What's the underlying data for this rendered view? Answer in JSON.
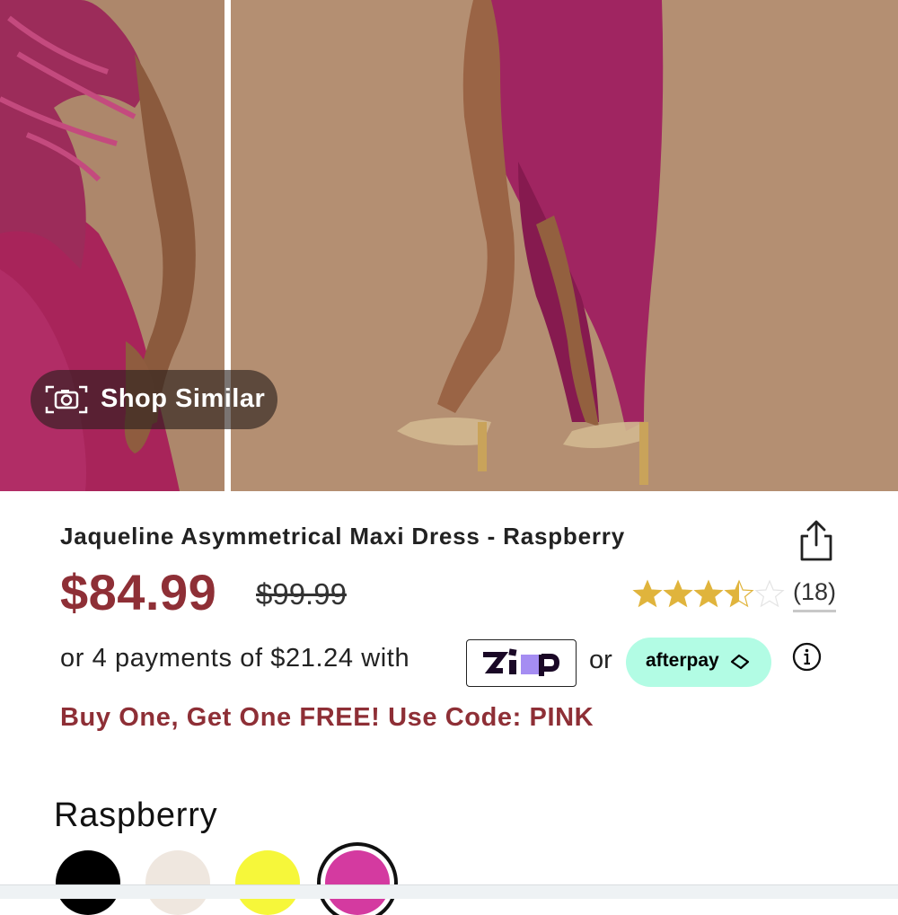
{
  "gallery": {
    "shop_similar_label": "Shop Similar"
  },
  "product": {
    "title": "Jaqueline Asymmetrical Maxi Dress - Raspberry",
    "price": "$84.99",
    "original_price": "$99.99",
    "rating": 3.5,
    "rating_max": 5,
    "review_count": "(18)",
    "payments_text": "or 4 payments of $21.24 with",
    "zip_logo_text": "zip",
    "or_text": "or",
    "afterpay_label": "afterpay",
    "promo_text": "Buy One, Get One FREE! Use Code: PINK",
    "selected_color": "Raspberry"
  },
  "colors": {
    "price": "#8e2f36",
    "star": "#e0b43c",
    "afterpay_bg": "#b2fce4"
  },
  "swatches": [
    {
      "name": "black",
      "color": "#000000",
      "selected": false
    },
    {
      "name": "cream",
      "color": "#efe7df",
      "selected": false
    },
    {
      "name": "yellow",
      "color": "#f6f73a",
      "selected": false
    },
    {
      "name": "raspberry",
      "color": "#d43aa0",
      "selected": true
    }
  ],
  "icons": {
    "camera": "camera-icon",
    "share": "share-icon",
    "info": "info-icon",
    "star": "star-icon"
  }
}
